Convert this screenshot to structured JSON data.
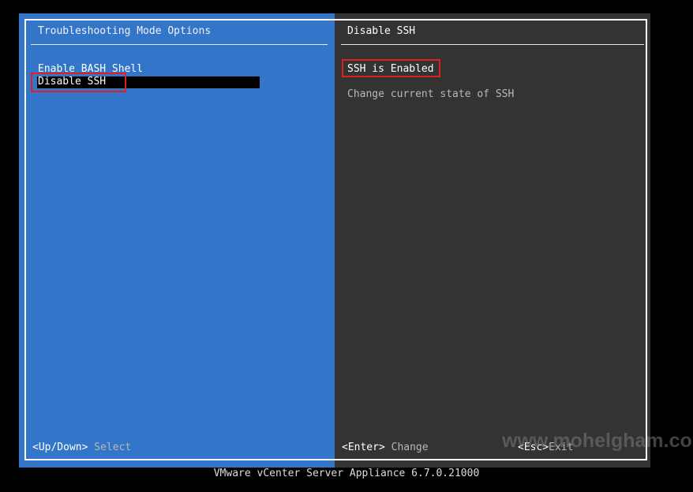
{
  "left_panel": {
    "title": "Troubleshooting Mode Options",
    "menu_items": [
      {
        "label": "Enable BASH Shell"
      },
      {
        "label": "Disable SSH",
        "selected": true
      }
    ],
    "footer": {
      "key": "<Up/Down>",
      "action": "Select"
    }
  },
  "right_panel": {
    "title": "Disable SSH",
    "status": "SSH is Enabled",
    "description": "Change current state of SSH",
    "footer_enter": {
      "key": "<Enter>",
      "action": "Change"
    },
    "footer_esc": {
      "key": "<Esc>",
      "action": "Exit"
    }
  },
  "product_line": "VMware vCenter Server Appliance 6.7.0.21000",
  "watermark": "www.mohelgham.com",
  "colors": {
    "left_bg": "#3375c8",
    "right_bg": "#333333",
    "selection_bg": "#000000",
    "highlight_box": "#e02020"
  }
}
